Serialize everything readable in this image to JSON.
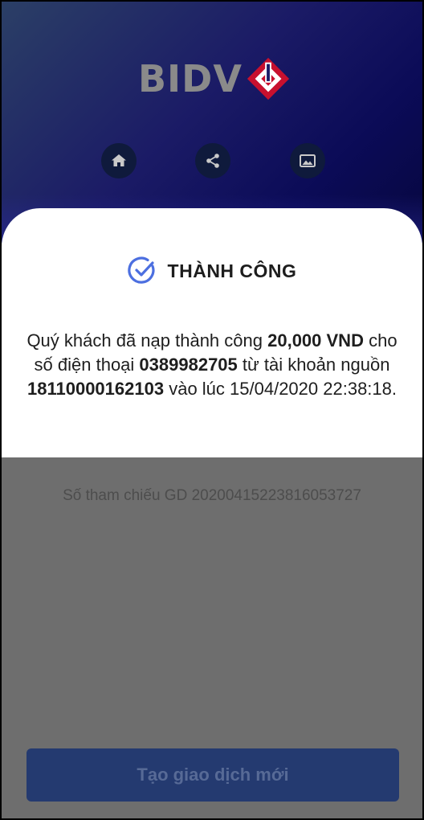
{
  "brand": {
    "logo_text": "BIDV",
    "colors": {
      "header_dark": "#0b0b57",
      "logo_red": "#c8102e",
      "success_blue": "#4c6fe0",
      "button_bg": "#243a70"
    }
  },
  "header_actions": [
    {
      "icon": "home-icon"
    },
    {
      "icon": "share-icon"
    },
    {
      "icon": "image-icon"
    }
  ],
  "result": {
    "status": "THÀNH CÔNG",
    "message_prefix": "Quý khách đã nạp thành công ",
    "amount": "20,000 VND",
    "message_mid": " cho số điện thoại ",
    "phone": "0389982705",
    "message_mid2": " từ tài khoản nguồn ",
    "source_account": "18110000162103",
    "message_suffix": " vào lúc 15/04/2020 22:38:18."
  },
  "reference": {
    "label": "Số tham chiếu GD",
    "value": "20200415223816053727"
  },
  "primary_action": {
    "label": "Tạo giao dịch mới"
  }
}
